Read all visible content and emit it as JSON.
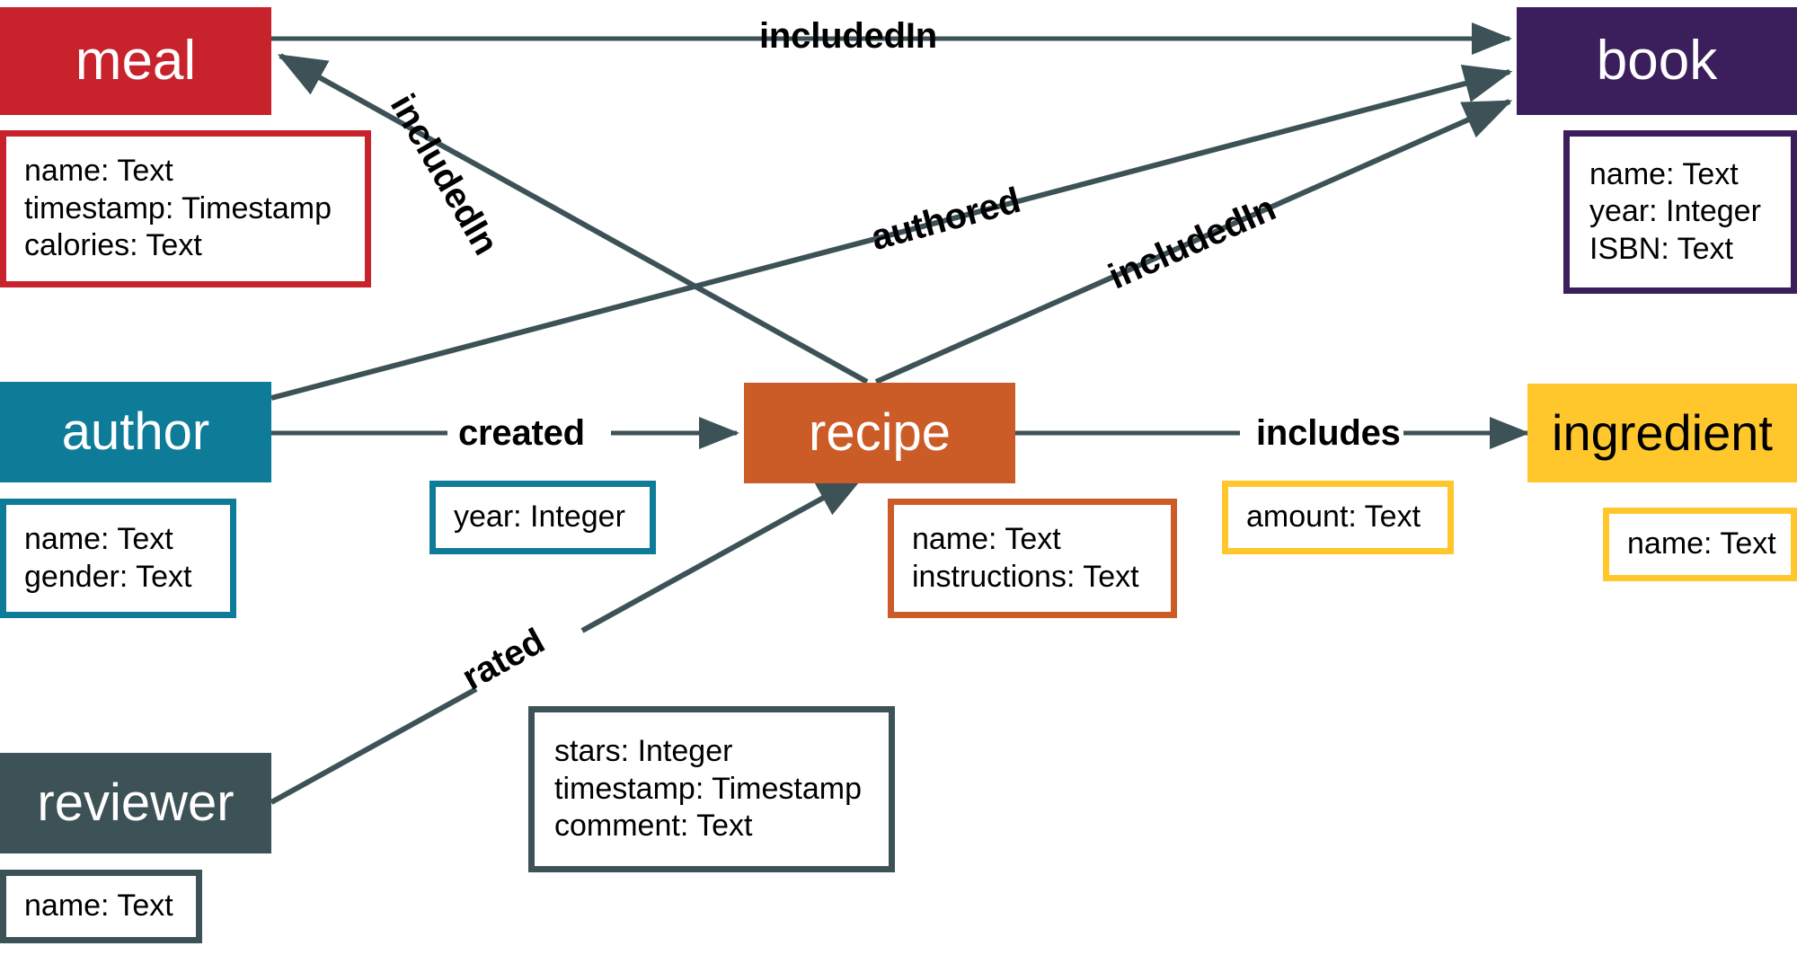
{
  "diagram": {
    "title": "recipe database entity relationship diagram",
    "background": "#ffffff",
    "edge_color": "#3D5257",
    "entities": [
      {
        "id": "meal",
        "label": "meal",
        "color": "#C8232C",
        "label_color": "#ffffff",
        "attributes": [
          "name: Text",
          "timestamp: Timestamp",
          "calories: Text"
        ]
      },
      {
        "id": "book",
        "label": "book",
        "color": "#3B1E5C",
        "label_color": "#ffffff",
        "attributes": [
          "name: Text",
          "year: Integer",
          "ISBN: Text"
        ]
      },
      {
        "id": "author",
        "label": "author",
        "color": "#0E7C99",
        "label_color": "#ffffff",
        "attributes": [
          "name: Text",
          "gender: Text"
        ]
      },
      {
        "id": "recipe",
        "label": "recipe",
        "color": "#CB5C27",
        "label_color": "#ffffff",
        "attributes": [
          "name: Text",
          "instructions: Text"
        ]
      },
      {
        "id": "ingredient",
        "label": "ingredient",
        "color": "#FFC72C",
        "label_color": "#000000",
        "attributes": [
          "name: Text"
        ]
      },
      {
        "id": "reviewer",
        "label": "reviewer",
        "color": "#3D5257",
        "label_color": "#ffffff",
        "attributes": [
          "name: Text"
        ]
      }
    ],
    "relationships": [
      {
        "id": "meal-includedin-book",
        "label": "includedIn",
        "from": "meal",
        "to": "book",
        "attributes": []
      },
      {
        "id": "recipe-includedin-meal",
        "label": "includedIn",
        "from": "recipe",
        "to": "meal",
        "attributes": []
      },
      {
        "id": "author-authored-book",
        "label": "authored",
        "from": "author",
        "to": "book",
        "attributes": []
      },
      {
        "id": "recipe-includedin-book",
        "label": "includedIn",
        "from": "recipe",
        "to": "book",
        "attributes": []
      },
      {
        "id": "author-created-recipe",
        "label": "created",
        "from": "author",
        "to": "recipe",
        "attributes": [
          "year: Integer"
        ],
        "attr_color": "#0E7C99"
      },
      {
        "id": "recipe-includes-ingredient",
        "label": "includes",
        "from": "recipe",
        "to": "ingredient",
        "attributes": [
          "amount: Text"
        ],
        "attr_color": "#FFC72C"
      },
      {
        "id": "reviewer-rated-recipe",
        "label": "rated",
        "from": "reviewer",
        "to": "recipe",
        "attributes": [
          "stars: Integer",
          "timestamp: Timestamp",
          "comment: Text"
        ],
        "attr_color": "#3D5257"
      }
    ]
  }
}
